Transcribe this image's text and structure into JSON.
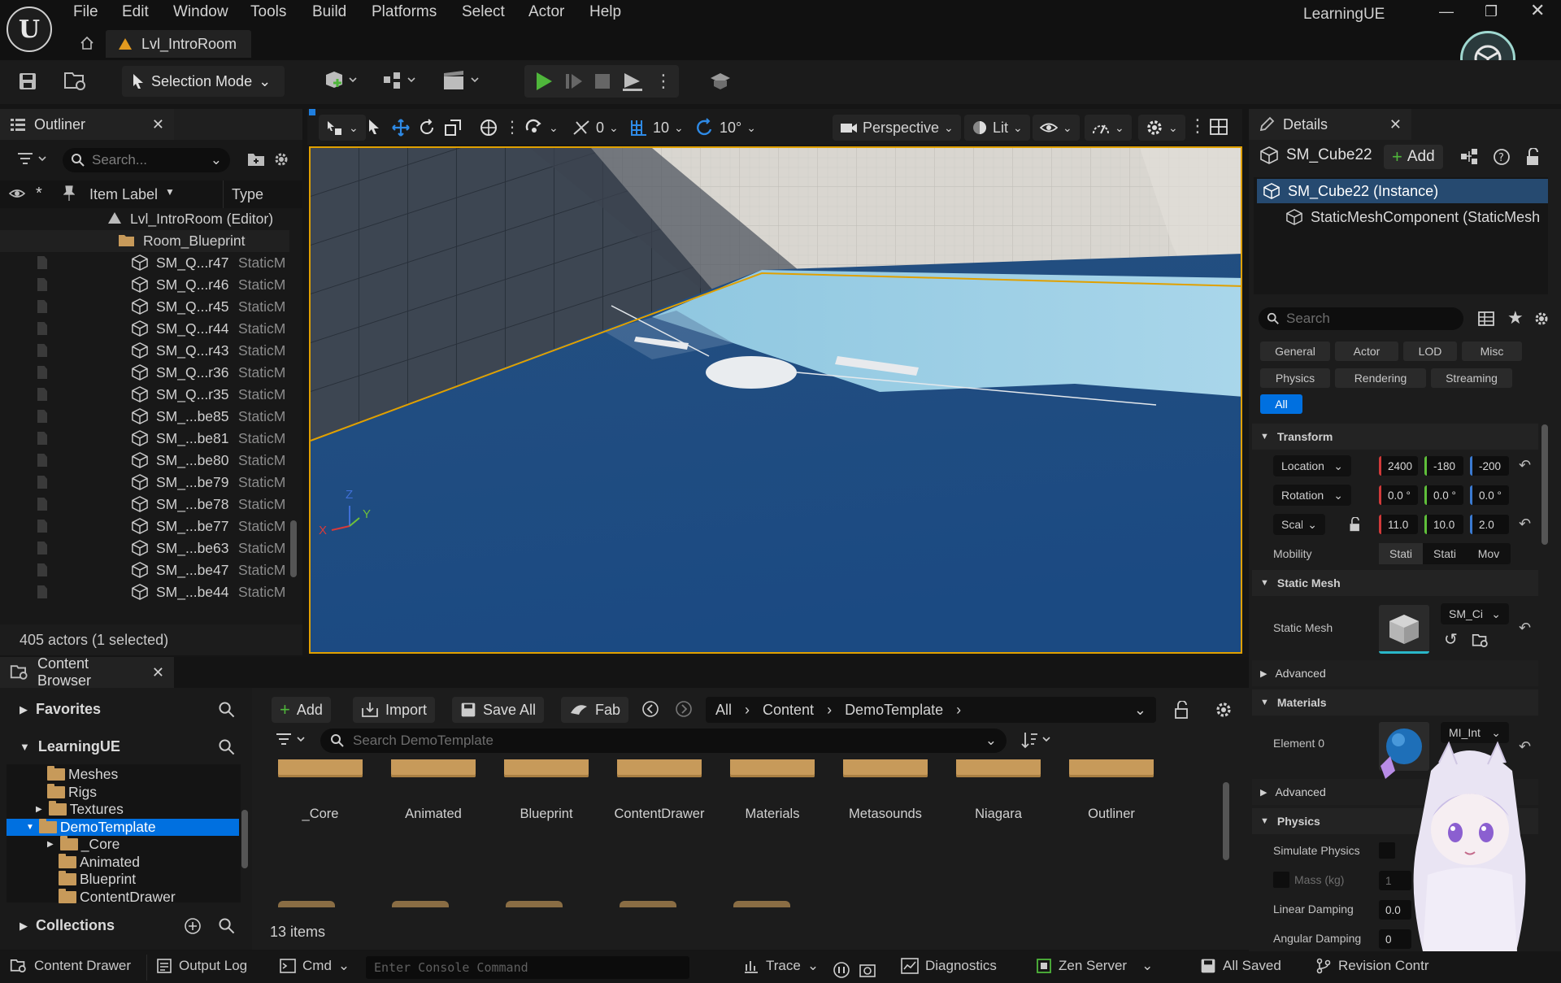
{
  "window": {
    "project_name": "LearningUE",
    "menu": [
      "File",
      "Edit",
      "Window",
      "Tools",
      "Build",
      "Platforms",
      "Select",
      "Actor",
      "Help"
    ],
    "level_tab": "Lvl_IntroRoom"
  },
  "toolbar": {
    "selection_mode": "Selection Mode"
  },
  "viewport": {
    "snap_rotation": "0",
    "snap_grid": "10",
    "snap_angle": "10°",
    "view_mode": "Perspective",
    "lighting": "Lit",
    "axis_labels": {
      "x": "X",
      "y": "Y",
      "z": "Z"
    }
  },
  "outliner": {
    "title": "Outliner",
    "search_placeholder": "Search...",
    "col_label": "Item Label",
    "col_type": "Type",
    "root": "Lvl_IntroRoom (Editor)",
    "folder": "Room_Blueprint",
    "rows": [
      {
        "name": "SM_Q...r47",
        "type": "StaticM"
      },
      {
        "name": "SM_Q...r46",
        "type": "StaticM"
      },
      {
        "name": "SM_Q...r45",
        "type": "StaticM"
      },
      {
        "name": "SM_Q...r44",
        "type": "StaticM"
      },
      {
        "name": "SM_Q...r43",
        "type": "StaticM"
      },
      {
        "name": "SM_Q...r36",
        "type": "StaticM"
      },
      {
        "name": "SM_Q...r35",
        "type": "StaticM"
      },
      {
        "name": "SM_...be85",
        "type": "StaticM"
      },
      {
        "name": "SM_...be81",
        "type": "StaticM"
      },
      {
        "name": "SM_...be80",
        "type": "StaticM"
      },
      {
        "name": "SM_...be79",
        "type": "StaticM"
      },
      {
        "name": "SM_...be78",
        "type": "StaticM"
      },
      {
        "name": "SM_...be77",
        "type": "StaticM"
      },
      {
        "name": "SM_...be63",
        "type": "StaticM"
      },
      {
        "name": "SM_...be47",
        "type": "StaticM"
      },
      {
        "name": "SM_...be44",
        "type": "StaticM"
      }
    ],
    "status": "405 actors (1 selected)"
  },
  "details": {
    "title": "Details",
    "actor_name": "SM_Cube22",
    "add_label": "Add",
    "instance": "SM_Cube22 (Instance)",
    "component": "StaticMeshComponent (StaticMesh",
    "search_placeholder": "Search",
    "filter_tabs": [
      "General",
      "Actor",
      "LOD",
      "Misc",
      "Physics",
      "Rendering",
      "Streaming"
    ],
    "filter_all": "All",
    "transform": {
      "header": "Transform",
      "location_label": "Location",
      "location": [
        "2400",
        "-180",
        "-200"
      ],
      "rotation_label": "Rotation",
      "rotation": [
        "0.0 °",
        "0.0 °",
        "0.0 °"
      ],
      "scale_label": "Scale",
      "scale": [
        "11.0",
        "10.0",
        "2.0"
      ],
      "mobility_label": "Mobility",
      "mobility": [
        "Stati",
        "Stati",
        "Mov"
      ]
    },
    "static_mesh": {
      "header": "Static Mesh",
      "label": "Static Mesh",
      "value": "SM_Ci"
    },
    "advanced": "Advanced",
    "materials": {
      "header": "Materials",
      "element_label": "Element 0",
      "value": "MI_Int"
    },
    "physics": {
      "header": "Physics",
      "simulate": "Simulate Physics",
      "mass": "Mass (kg)",
      "linear": "Linear Damping",
      "angular": "Angular Damping",
      "mass_value": "1",
      "linear_value": "0.0",
      "angular_value": "0"
    }
  },
  "content_browser": {
    "tab": "Content Browser",
    "favorites": "Favorites",
    "project": "LearningUE",
    "tree": [
      {
        "label": "Meshes",
        "level": 1
      },
      {
        "label": "Rigs",
        "level": 1
      },
      {
        "label": "Textures",
        "level": 1
      },
      {
        "label": "DemoTemplate",
        "level": 0
      },
      {
        "label": "_Core",
        "level": 2
      },
      {
        "label": "Animated",
        "level": 2
      },
      {
        "label": "Blueprint",
        "level": 2
      },
      {
        "label": "ContentDrawer",
        "level": 2
      }
    ],
    "collections": "Collections",
    "buttons": {
      "add": "Add",
      "import": "Import",
      "save_all": "Save All",
      "fab": "Fab"
    },
    "breadcrumb": [
      "All",
      "Content",
      "DemoTemplate"
    ],
    "search_placeholder": "Search DemoTemplate",
    "folders": [
      "_Core",
      "Animated",
      "Blueprint",
      "ContentDrawer",
      "Materials",
      "Metasounds",
      "Niagara",
      "Outliner"
    ],
    "item_count": "13 items"
  },
  "statusbar": {
    "content_drawer": "Content Drawer",
    "output_log": "Output Log",
    "cmd": "Cmd",
    "console_placeholder": "Enter Console Command",
    "trace": "Trace",
    "diagnostics": "Diagnostics",
    "zen_server": "Zen Server",
    "all_saved": "All Saved",
    "revision": "Revision Contr"
  },
  "colors": {
    "accent_selection": "#0070e0",
    "play_green": "#4fb63b",
    "selection_outline": "#e0a000"
  }
}
